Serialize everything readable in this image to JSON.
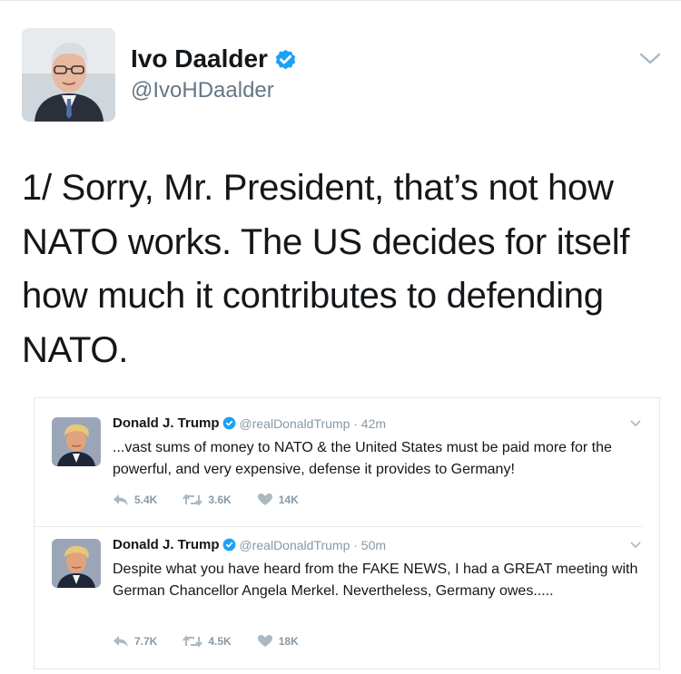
{
  "tweet": {
    "author_name": "Ivo Daalder",
    "author_handle": "@IvoHDaalder",
    "text": "1/ Sorry, Mr. President, that’s not how NATO works. The US decides for itself how much it contributes to defending NATO."
  },
  "quoted": [
    {
      "name": "Donald J. Trump",
      "handle_time": "@realDonaldTrump · 42m",
      "text": "...vast sums of money to NATO & the United States must be paid more for the powerful, and very expensive, defense it provides to Germany!",
      "replies": "5.4K",
      "retweets": "3.6K",
      "likes": "14K"
    },
    {
      "name": "Donald J. Trump",
      "handle_time": "@realDonaldTrump · 50m",
      "text": "Despite what you have heard from the FAKE NEWS, I had a GREAT meeting with German Chancellor Angela Merkel. Nevertheless, Germany owes.....",
      "replies": "7.7K",
      "retweets": "4.5K",
      "likes": "18K"
    }
  ],
  "colors": {
    "verified_blue": "#1da1f2",
    "secondary_text": "#657786",
    "muted_text": "#8899a6",
    "border": "#e1e8ed"
  },
  "icons": [
    "verified-badge-icon",
    "chevron-down-icon",
    "reply-icon",
    "retweet-icon",
    "like-icon"
  ]
}
